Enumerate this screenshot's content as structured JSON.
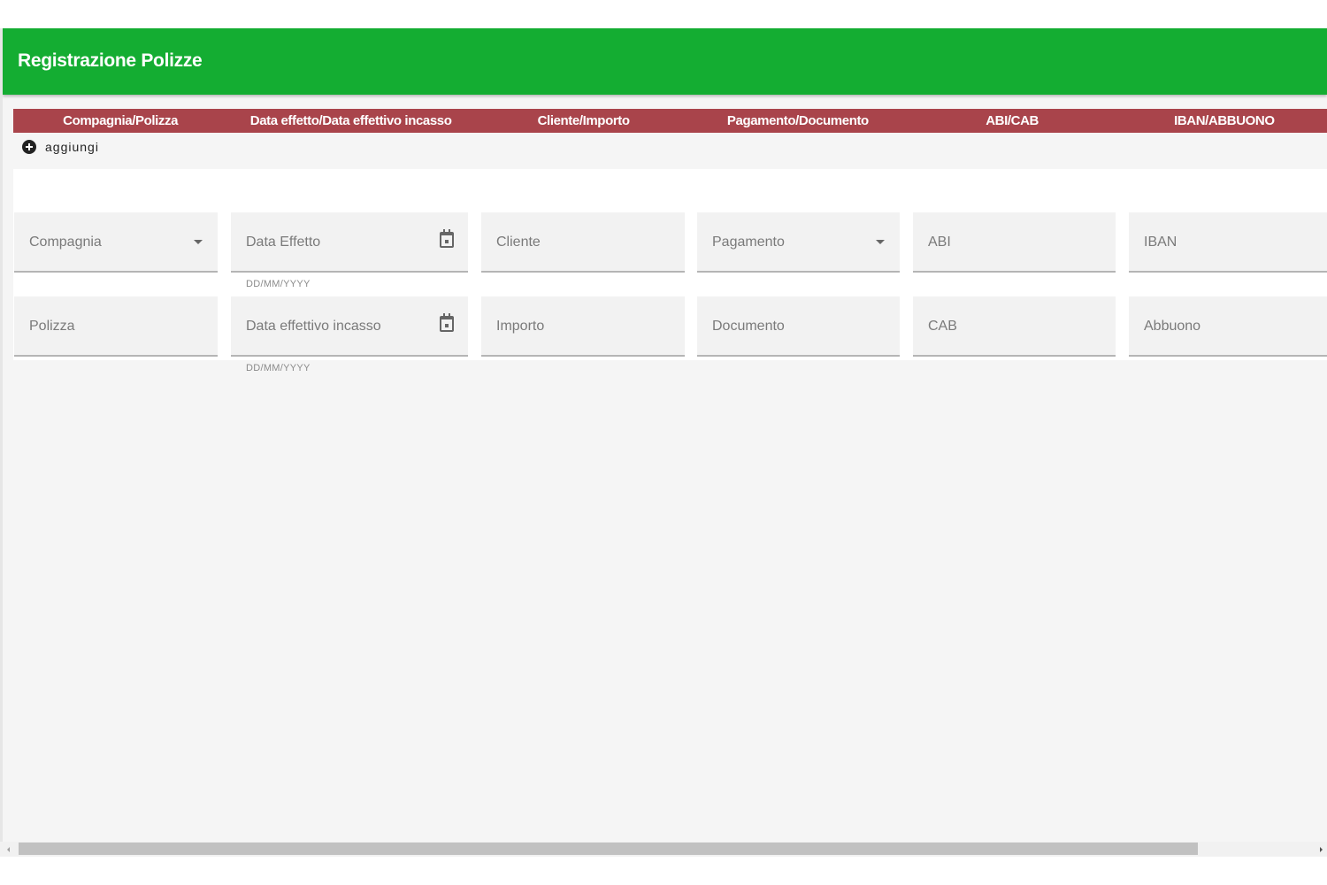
{
  "toolbar": {
    "title": "Registrazione Polizze",
    "color": "#14ad32"
  },
  "table_header": {
    "color": "#a9444b",
    "columns": [
      "Compagnia/Polizza",
      "Data effetto/Data effettivo incasso",
      "Cliente/Importo",
      "Pagamento/Documento",
      "ABI/CAB",
      "IBAN/ABBUONO"
    ]
  },
  "add_action": {
    "label": "aggiungi",
    "icon": "add-circle-icon"
  },
  "form": {
    "row1": {
      "compagnia": {
        "label": "Compagnia",
        "value": "",
        "type": "select"
      },
      "data_effetto": {
        "label": "Data Effetto",
        "value": "",
        "hint": "DD/MM/YYYY",
        "type": "date"
      },
      "cliente": {
        "label": "Cliente",
        "value": ""
      },
      "pagamento": {
        "label": "Pagamento",
        "value": "",
        "type": "select"
      },
      "abi": {
        "label": "ABI",
        "value": ""
      },
      "iban": {
        "label": "IBAN",
        "value": ""
      }
    },
    "row2": {
      "polizza": {
        "label": "Polizza",
        "value": ""
      },
      "data_incasso": {
        "label": "Data effettivo incasso",
        "value": "",
        "hint": "DD/MM/YYYY",
        "type": "date"
      },
      "importo": {
        "label": "Importo",
        "value": ""
      },
      "documento": {
        "label": "Documento",
        "value": ""
      },
      "cab": {
        "label": "CAB",
        "value": ""
      },
      "abbuono": {
        "label": "Abbuono",
        "value": ""
      }
    }
  }
}
